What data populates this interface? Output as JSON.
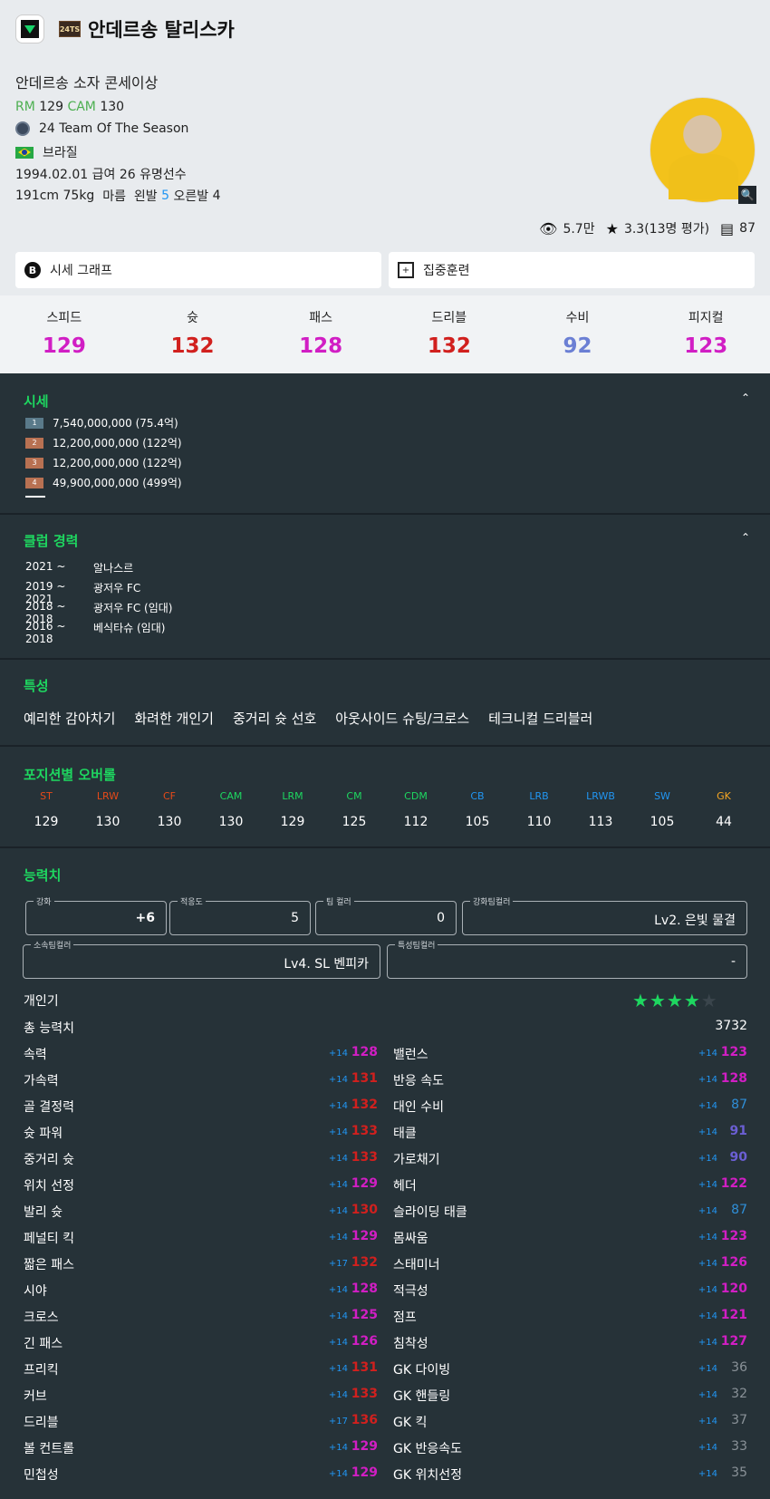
{
  "header": {
    "player_name": "안데르송 탈리스카",
    "season_badge": "24TS",
    "full_name": "안데르송 소자 콘세이상",
    "positions": [
      {
        "pos": "RM",
        "ovr": "129"
      },
      {
        "pos": "CAM",
        "ovr": "130"
      }
    ],
    "season": "24 Team Of The Season",
    "nationality": "브라질",
    "birth_salary_status": "1994.02.01  급여 26  유명선수",
    "body": {
      "height_weight": "191cm 75kg",
      "build": "마름",
      "left_label": "왼발",
      "left_value": "5",
      "right_label": "오른발",
      "right_value": "4"
    },
    "views": "5.7만",
    "rating": "3.3(13명 평가)",
    "comments": "87"
  },
  "buttons": {
    "price_graph": "시세 그래프",
    "training": "집중훈련"
  },
  "overall_stats": [
    {
      "label": "스피드",
      "value": "129",
      "color": "#d11ec4"
    },
    {
      "label": "슛",
      "value": "132",
      "color": "#d1201e"
    },
    {
      "label": "패스",
      "value": "128",
      "color": "#d11ec4"
    },
    {
      "label": "드리블",
      "value": "132",
      "color": "#d1201e"
    },
    {
      "label": "수비",
      "value": "92",
      "color": "#6b7fd4"
    },
    {
      "label": "피지컬",
      "value": "123",
      "color": "#d11ec4"
    }
  ],
  "price": {
    "title": "시세",
    "rows": [
      {
        "rank": "1",
        "value": "7,540,000,000 (75.4억)",
        "color": "#5a7a8a"
      },
      {
        "rank": "2",
        "value": "12,200,000,000 (122억)",
        "color": "#b87152"
      },
      {
        "rank": "3",
        "value": "12,200,000,000 (122억)",
        "color": "#b87152"
      },
      {
        "rank": "4",
        "value": "49,900,000,000 (499억)",
        "color": "#b87152"
      }
    ]
  },
  "career": {
    "title": "클럽 경력",
    "rows": [
      {
        "years": "2021 ~",
        "club": "알나스르"
      },
      {
        "years": "2019 ~ 2021",
        "club": "광저우 FC"
      },
      {
        "years": "2018 ~ 2018",
        "club": "광저우 FC (임대)"
      },
      {
        "years": "2016 ~ 2018",
        "club": "베식타슈 (임대)"
      }
    ]
  },
  "traits": {
    "title": "특성",
    "items": [
      "예리한 감아차기",
      "화려한 개인기",
      "중거리 슛 선호",
      "아웃사이드 슈팅/크로스",
      "테크니컬 드리블러"
    ]
  },
  "positions_ovr": {
    "title": "포지션별 오버롤",
    "items": [
      {
        "pos": "ST",
        "value": "129",
        "color": "#e64a19"
      },
      {
        "pos": "LRW",
        "value": "130",
        "color": "#e64a19"
      },
      {
        "pos": "CF",
        "value": "130",
        "color": "#e64a19"
      },
      {
        "pos": "CAM",
        "value": "130",
        "color": "#1ed760"
      },
      {
        "pos": "LRM",
        "value": "129",
        "color": "#1ed760"
      },
      {
        "pos": "CM",
        "value": "125",
        "color": "#1ed760"
      },
      {
        "pos": "CDM",
        "value": "112",
        "color": "#1ed760"
      },
      {
        "pos": "CB",
        "value": "105",
        "color": "#2196f3"
      },
      {
        "pos": "LRB",
        "value": "110",
        "color": "#2196f3"
      },
      {
        "pos": "LRWB",
        "value": "113",
        "color": "#2196f3"
      },
      {
        "pos": "SW",
        "value": "105",
        "color": "#2196f3"
      },
      {
        "pos": "GK",
        "value": "44",
        "color": "#f5a623"
      }
    ]
  },
  "abilities": {
    "title": "능력치",
    "fields": {
      "upgrade": {
        "label": "강화",
        "value": "+6"
      },
      "adapt": {
        "label": "적응도",
        "value": "5"
      },
      "team_color": {
        "label": "팀 컬러",
        "value": "0"
      },
      "upgrade_team_color": {
        "label": "강화팀컬러",
        "value": "Lv2. 은빛 물결"
      },
      "club_team_color": {
        "label": "소속팀컬러",
        "value": "Lv4. SL 벤피카"
      },
      "trait_team_color": {
        "label": "특성팀컬러",
        "value": "-"
      }
    },
    "skill_moves_label": "개인기",
    "skill_moves_stars": 4,
    "total_label": "총 능력치",
    "total_value": "3732",
    "left": [
      {
        "name": "속력",
        "bonus": "+14",
        "value": "128",
        "color": "#d11ec4"
      },
      {
        "name": "가속력",
        "bonus": "+14",
        "value": "131",
        "color": "#d1201e"
      },
      {
        "name": "골 결정력",
        "bonus": "+14",
        "value": "132",
        "color": "#d1201e"
      },
      {
        "name": "슛 파워",
        "bonus": "+14",
        "value": "133",
        "color": "#d1201e"
      },
      {
        "name": "중거리 슛",
        "bonus": "+14",
        "value": "133",
        "color": "#d1201e"
      },
      {
        "name": "위치 선정",
        "bonus": "+14",
        "value": "129",
        "color": "#d11ec4"
      },
      {
        "name": "발리 슛",
        "bonus": "+14",
        "value": "130",
        "color": "#d1201e"
      },
      {
        "name": "페널티 킥",
        "bonus": "+14",
        "value": "129",
        "color": "#d11ec4"
      },
      {
        "name": "짧은 패스",
        "bonus": "+17",
        "value": "132",
        "color": "#d1201e"
      },
      {
        "name": "시야",
        "bonus": "+14",
        "value": "128",
        "color": "#d11ec4"
      },
      {
        "name": "크로스",
        "bonus": "+14",
        "value": "125",
        "color": "#d11ec4"
      },
      {
        "name": "긴 패스",
        "bonus": "+14",
        "value": "126",
        "color": "#d11ec4"
      },
      {
        "name": "프리킥",
        "bonus": "+14",
        "value": "131",
        "color": "#d1201e"
      },
      {
        "name": "커브",
        "bonus": "+14",
        "value": "133",
        "color": "#d1201e"
      },
      {
        "name": "드리블",
        "bonus": "+17",
        "value": "136",
        "color": "#d1201e"
      },
      {
        "name": "볼 컨트롤",
        "bonus": "+14",
        "value": "129",
        "color": "#d11ec4"
      },
      {
        "name": "민첩성",
        "bonus": "+14",
        "value": "129",
        "color": "#d11ec4"
      }
    ],
    "right": [
      {
        "name": "밸런스",
        "bonus": "+14",
        "value": "123",
        "color": "#d11ec4"
      },
      {
        "name": "반응 속도",
        "bonus": "+14",
        "value": "128",
        "color": "#d11ec4"
      },
      {
        "name": "대인 수비",
        "bonus": "+14",
        "value": "87",
        "color": "#2f8fd8"
      },
      {
        "name": "태클",
        "bonus": "+14",
        "value": "91",
        "color": "#6b5fd4"
      },
      {
        "name": "가로채기",
        "bonus": "+14",
        "value": "90",
        "color": "#6b5fd4"
      },
      {
        "name": "헤더",
        "bonus": "+14",
        "value": "122",
        "color": "#d11ec4"
      },
      {
        "name": "슬라이딩 태클",
        "bonus": "+14",
        "value": "87",
        "color": "#2f8fd8"
      },
      {
        "name": "몸싸움",
        "bonus": "+14",
        "value": "123",
        "color": "#d11ec4"
      },
      {
        "name": "스태미너",
        "bonus": "+14",
        "value": "126",
        "color": "#d11ec4"
      },
      {
        "name": "적극성",
        "bonus": "+14",
        "value": "120",
        "color": "#d11ec4"
      },
      {
        "name": "점프",
        "bonus": "+14",
        "value": "121",
        "color": "#d11ec4"
      },
      {
        "name": "침착성",
        "bonus": "+14",
        "value": "127",
        "color": "#d11ec4"
      },
      {
        "name": "GK 다이빙",
        "bonus": "+14",
        "value": "36",
        "color": "#8a9298"
      },
      {
        "name": "GK 핸들링",
        "bonus": "+14",
        "value": "32",
        "color": "#8a9298"
      },
      {
        "name": "GK 킥",
        "bonus": "+14",
        "value": "37",
        "color": "#8a9298"
      },
      {
        "name": "GK 반응속도",
        "bonus": "+14",
        "value": "33",
        "color": "#8a9298"
      },
      {
        "name": "GK 위치선정",
        "bonus": "+14",
        "value": "35",
        "color": "#8a9298"
      }
    ]
  }
}
